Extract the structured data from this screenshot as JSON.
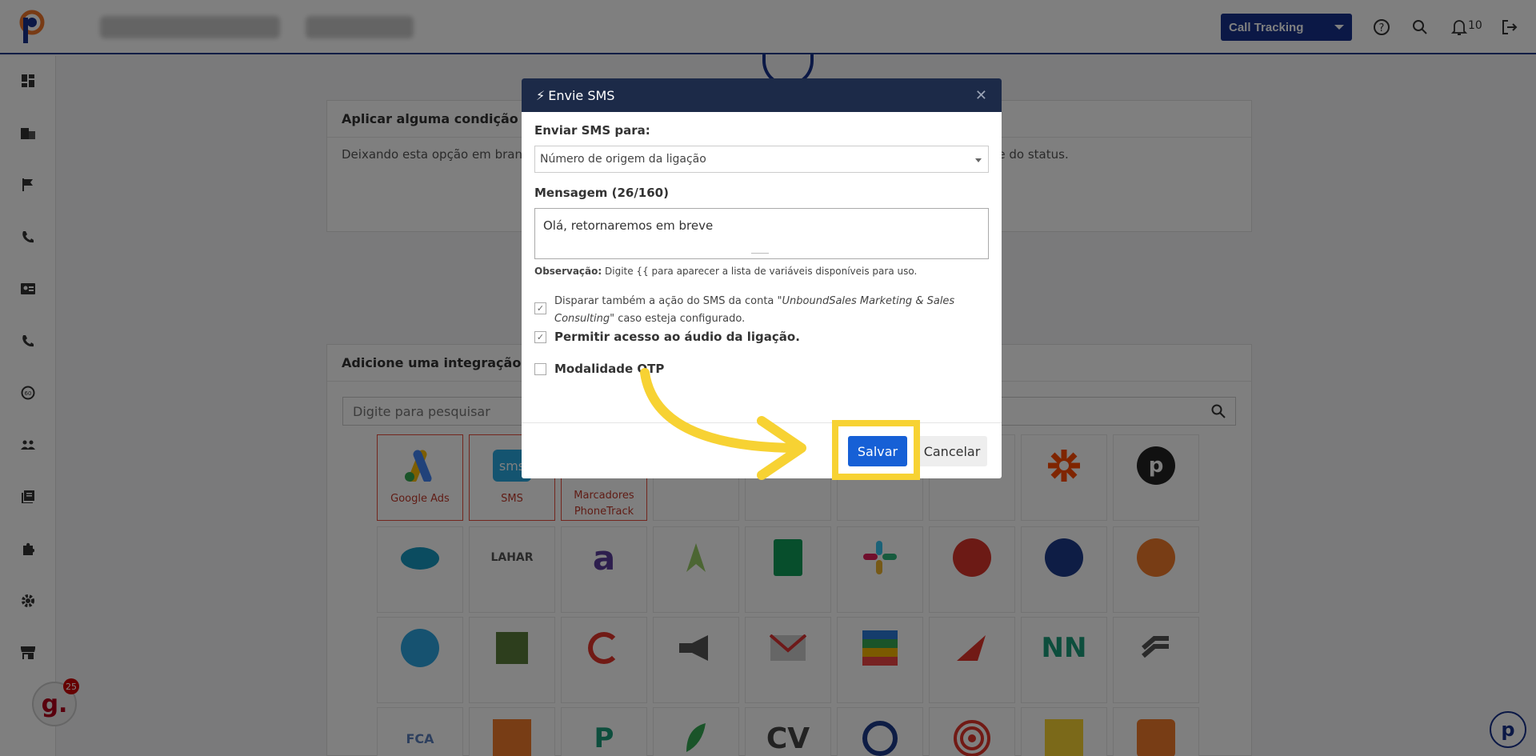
{
  "header": {
    "call_tracking_select": "Call Tracking",
    "notifications_count": "10",
    "icons": [
      "help-icon",
      "search-icon",
      "bell-icon",
      "logout-icon"
    ]
  },
  "sidebar": {
    "icons": [
      "dashboard-icon",
      "building-icon",
      "flag-icon",
      "phone-icon",
      "contact-card-icon",
      "phone-icon",
      "speed-icon",
      "users-icon",
      "book-icon",
      "puzzle-icon",
      "gear-icon",
      "store-icon"
    ]
  },
  "cards": {
    "condition_title": "Aplicar alguma condição par",
    "condition_text": "Deixando esta opção em branc",
    "condition_text_right": "nte do status.",
    "integration_title": "Adicione uma integração par",
    "search_placeholder": "Digite para pesquisar"
  },
  "integrations": [
    {
      "name": "Google Ads",
      "icon": "google-ads-icon"
    },
    {
      "name": "SMS",
      "icon": "sms-icon"
    },
    {
      "name": "Marcadores PhoneTrack",
      "icon": "marker-icon"
    }
  ],
  "modal": {
    "title": "Envie SMS",
    "send_to_label": "Enviar SMS para:",
    "send_to_value": "Número de origem da ligação",
    "message_label": "Mensagem (26/160)",
    "message_value": "Olá, retornaremos em breve",
    "obs_label": "Observação:",
    "obs_text": "Digite {{ para aparecer a lista de variáveis disponíveis para uso.",
    "chk1_text_a": "Disparar também a ação do SMS da conta ",
    "chk1_text_b": "\"UnboundSales Marketing & Sales Consulting\"",
    "chk1_text_c": " caso esteja configurado.",
    "chk2_text": "Permitir acesso ao áudio da ligação.",
    "chk3_text": "Modalidade OTP",
    "save_label": "Salvar",
    "cancel_label": "Cancelar"
  },
  "badges": {
    "g_count": "25",
    "g_letter": "g.",
    "p_letter": "p"
  }
}
